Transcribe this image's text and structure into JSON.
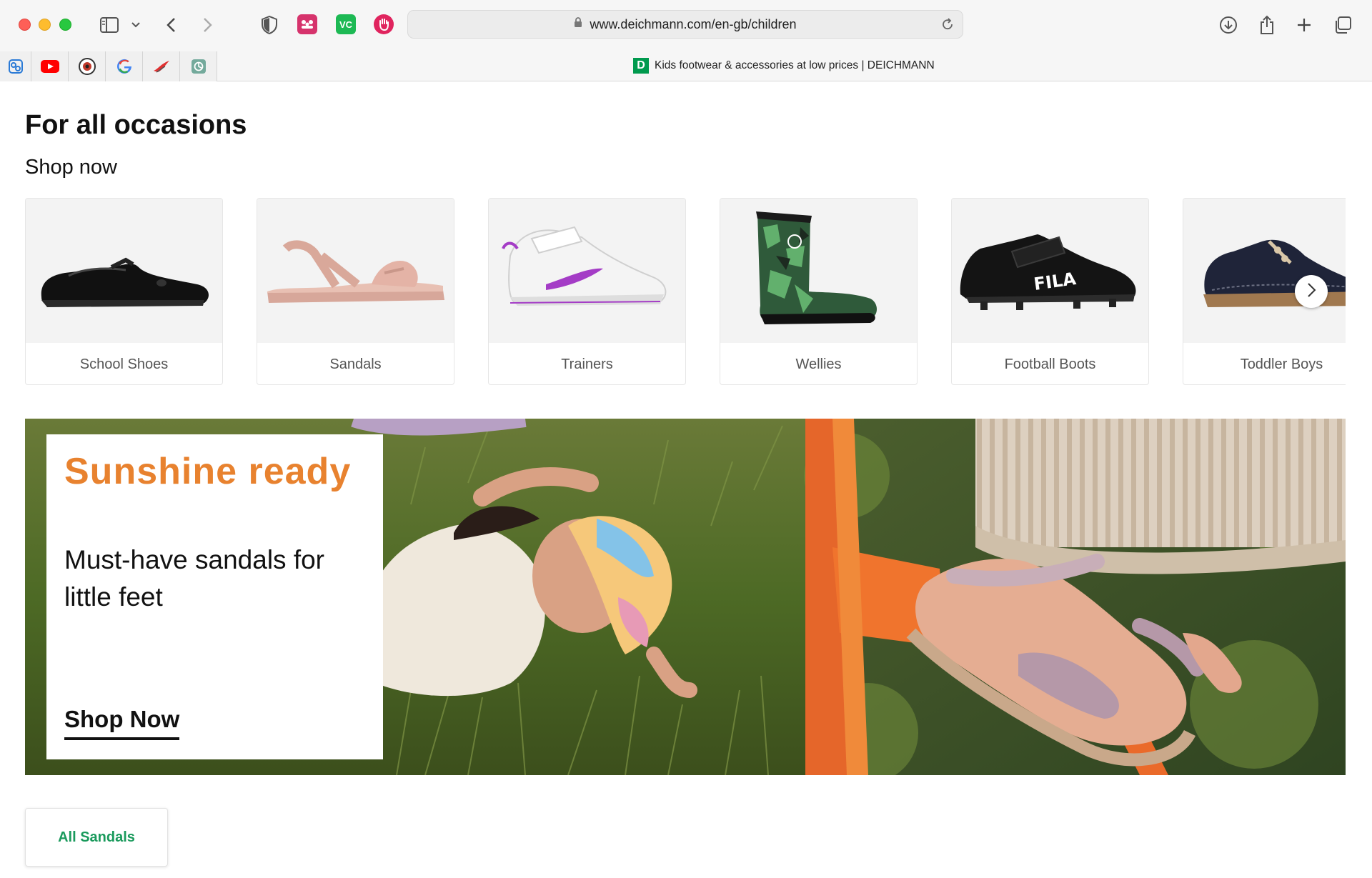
{
  "browser": {
    "url": "www.deichmann.com/en-gb/children",
    "tab_title": "Kids footwear & accessories at low prices | DEICHMANN",
    "favicon_letter": "D",
    "extensions": [
      {
        "name": "shield-icon"
      },
      {
        "name": "mendeley-icon",
        "color": "#d6336c"
      },
      {
        "name": "vc-extension-icon",
        "label": "VC",
        "color": "#1db954"
      },
      {
        "name": "adblock-hand-icon",
        "color": "#e0245e"
      }
    ],
    "bookmarks": [
      "notion-like-icon",
      "youtube-icon",
      "avatar-icon",
      "google-icon",
      "red-logo-icon",
      "chatgpt-icon"
    ]
  },
  "section": {
    "title": "For all occasions",
    "subtitle": "Shop now"
  },
  "categories": [
    {
      "label": "School Shoes",
      "icon": "school-shoe-image"
    },
    {
      "label": "Sandals",
      "icon": "sandal-image"
    },
    {
      "label": "Trainers",
      "icon": "trainer-image"
    },
    {
      "label": "Wellies",
      "icon": "wellie-image"
    },
    {
      "label": "Football Boots",
      "icon": "football-boot-image"
    },
    {
      "label": "Toddler Boys",
      "icon": "toddler-shoe-image"
    }
  ],
  "banner": {
    "headline": "Sunshine ready",
    "text": "Must-have sandals for little feet",
    "cta": "Shop Now",
    "accent_color": "#e8822f"
  },
  "footer_button": {
    "label": "All Sandals",
    "color": "#1a9a5c"
  }
}
